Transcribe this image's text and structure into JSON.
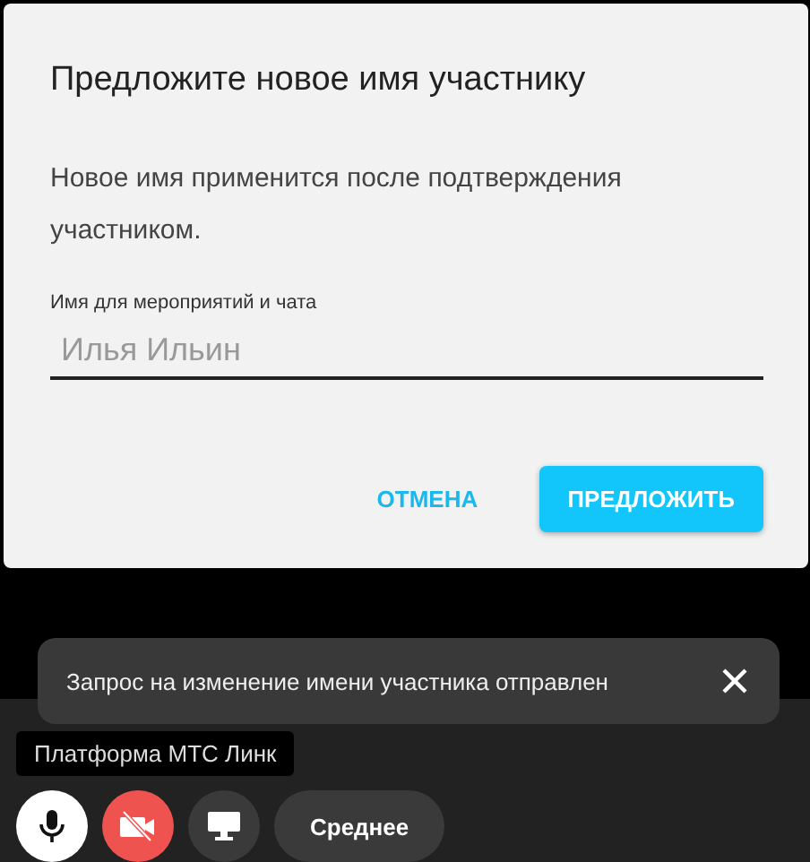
{
  "dialog": {
    "title": "Предложите новое имя участнику",
    "description": "Новое имя применится после подтверждения участником.",
    "field": {
      "label": "Имя для мероприятий и чата",
      "placeholder": "Илья Ильин"
    },
    "buttons": [
      {
        "label": "ОТМЕНА",
        "kind": "text"
      },
      {
        "label": "ПРЕДЛОЖИТЬ",
        "kind": "primary"
      }
    ]
  },
  "toast": {
    "message": "Запрос на изменение имени участника отправлен"
  },
  "participant_label": "Платформа МТС Линк",
  "controls": {
    "microphone_on": true,
    "camera_on": false,
    "quality": "Среднее"
  }
}
